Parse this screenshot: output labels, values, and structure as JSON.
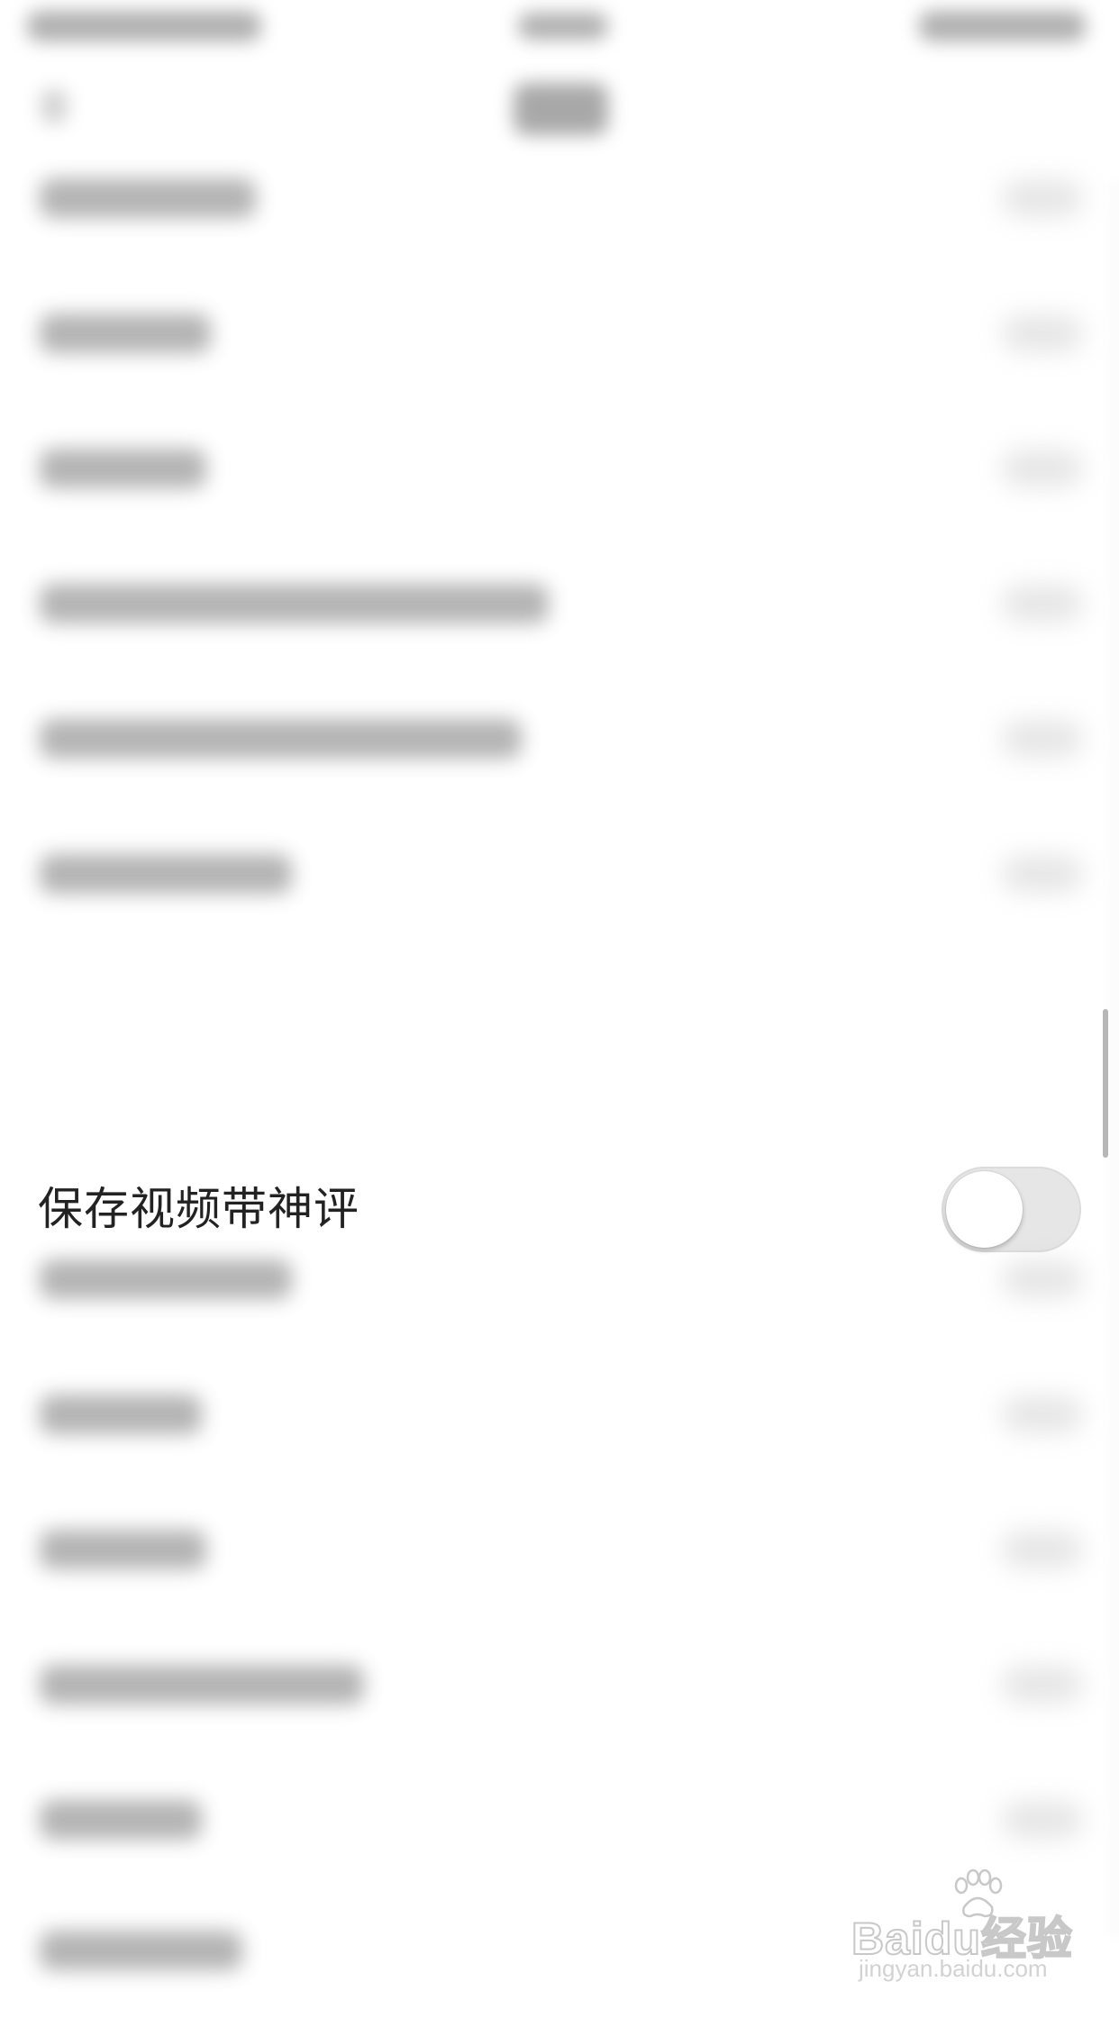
{
  "settings": {
    "highlighted_row": {
      "label": "保存视频带神评",
      "toggle_on": false
    }
  },
  "watermark": {
    "logo_text": "Baidu经验",
    "url": "jingyan.baidu.com"
  },
  "colors": {
    "background": "#ffffff",
    "label_text": "#222222",
    "toggle_track_off": "#e6e6e6",
    "toggle_knob": "#ffffff"
  }
}
